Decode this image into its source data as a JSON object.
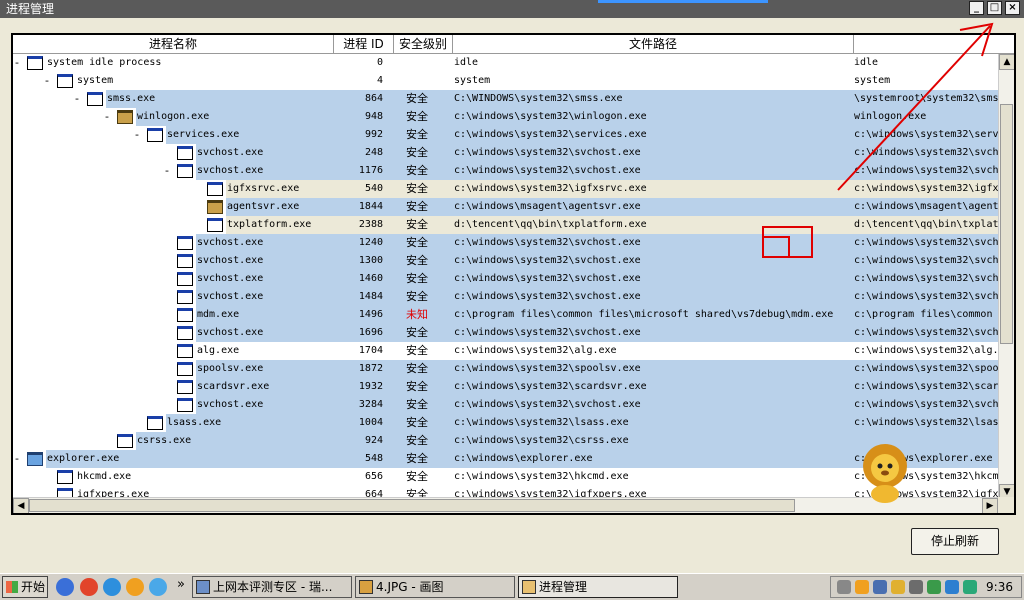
{
  "window": {
    "title": "进程管理",
    "minimize": "_",
    "maximize": "□",
    "close": "×"
  },
  "columns": [
    "进程名称",
    "进程 ID",
    "安全级别",
    "文件路径",
    ""
  ],
  "rows": [
    {
      "exp": "-",
      "name": "system idle process",
      "pid": "0",
      "sec": "",
      "path": "idle",
      "path2": "idle",
      "level": 0,
      "hl": false
    },
    {
      "exp": "-",
      "name": "system",
      "pid": "4",
      "sec": "",
      "path": "system",
      "path2": "system",
      "level": 1,
      "hl": false
    },
    {
      "exp": "-",
      "name": "smss.exe",
      "pid": "864",
      "sec": "安全",
      "path": "C:\\WINDOWS\\system32\\smss.exe",
      "path2": "\\systemroot\\system32\\smss",
      "level": 2,
      "hl": true
    },
    {
      "exp": "-",
      "name": "winlogon.exe",
      "pid": "948",
      "sec": "安全",
      "path": "c:\\windows\\system32\\winlogon.exe",
      "path2": "winlogon.exe",
      "level": 3,
      "hl": true,
      "icon": "special"
    },
    {
      "exp": "-",
      "name": "services.exe",
      "pid": "992",
      "sec": "安全",
      "path": "c:\\windows\\system32\\services.exe",
      "path2": "c:\\windows\\system32\\serv",
      "level": 4,
      "hl": true
    },
    {
      "exp": "",
      "name": "svchost.exe",
      "pid": "248",
      "sec": "安全",
      "path": "c:\\windows\\system32\\svchost.exe",
      "path2": "c:\\windows\\system32\\svch",
      "level": 5,
      "hl": true
    },
    {
      "exp": "-",
      "name": "svchost.exe",
      "pid": "1176",
      "sec": "安全",
      "path": "c:\\windows\\system32\\svchost.exe",
      "path2": "c:\\windows\\system32\\svch",
      "level": 5,
      "hl": true
    },
    {
      "exp": "",
      "name": "igfxsrvc.exe",
      "pid": "540",
      "sec": "安全",
      "path": "c:\\windows\\system32\\igfxsrvc.exe",
      "path2": "c:\\windows\\system32\\igfx",
      "level": 6,
      "hl": false,
      "beige": true
    },
    {
      "exp": "",
      "name": "agentsvr.exe",
      "pid": "1844",
      "sec": "安全",
      "path": "c:\\windows\\msagent\\agentsvr.exe",
      "path2": "c:\\windows\\msagent\\agent",
      "level": 6,
      "hl": true,
      "icon": "special"
    },
    {
      "exp": "",
      "name": "txplatform.exe",
      "pid": "2388",
      "sec": "安全",
      "path": "d:\\tencent\\qq\\bin\\txplatform.exe",
      "path2": "d:\\tencent\\qq\\bin\\txplat",
      "level": 6,
      "hl": false,
      "beige": true
    },
    {
      "exp": "",
      "name": "svchost.exe",
      "pid": "1240",
      "sec": "安全",
      "path": "c:\\windows\\system32\\svchost.exe",
      "path2": "c:\\windows\\system32\\svch",
      "level": 5,
      "hl": true
    },
    {
      "exp": "",
      "name": "svchost.exe",
      "pid": "1300",
      "sec": "安全",
      "path": "c:\\windows\\system32\\svchost.exe",
      "path2": "c:\\windows\\system32\\svch",
      "level": 5,
      "hl": true
    },
    {
      "exp": "",
      "name": "svchost.exe",
      "pid": "1460",
      "sec": "安全",
      "path": "c:\\windows\\system32\\svchost.exe",
      "path2": "c:\\windows\\system32\\svch",
      "level": 5,
      "hl": true
    },
    {
      "exp": "",
      "name": "svchost.exe",
      "pid": "1484",
      "sec": "安全",
      "path": "c:\\windows\\system32\\svchost.exe",
      "path2": "c:\\windows\\system32\\svch",
      "level": 5,
      "hl": true
    },
    {
      "exp": "",
      "name": "mdm.exe",
      "pid": "1496",
      "sec": "未知",
      "path": "c:\\program files\\common files\\microsoft shared\\vs7debug\\mdm.exe",
      "path2": "c:\\program files\\common",
      "level": 5,
      "hl": true,
      "unknown": true
    },
    {
      "exp": "",
      "name": "svchost.exe",
      "pid": "1696",
      "sec": "安全",
      "path": "c:\\windows\\system32\\svchost.exe",
      "path2": "c:\\windows\\system32\\svch",
      "level": 5,
      "hl": true
    },
    {
      "exp": "",
      "name": "alg.exe",
      "pid": "1704",
      "sec": "安全",
      "path": "c:\\windows\\system32\\alg.exe",
      "path2": "c:\\windows\\system32\\alg.",
      "level": 5,
      "hl": false
    },
    {
      "exp": "",
      "name": "spoolsv.exe",
      "pid": "1872",
      "sec": "安全",
      "path": "c:\\windows\\system32\\spoolsv.exe",
      "path2": "c:\\windows\\system32\\spoo",
      "level": 5,
      "hl": true
    },
    {
      "exp": "",
      "name": "scardsvr.exe",
      "pid": "1932",
      "sec": "安全",
      "path": "c:\\windows\\system32\\scardsvr.exe",
      "path2": "c:\\windows\\system32\\scar",
      "level": 5,
      "hl": true
    },
    {
      "exp": "",
      "name": "svchost.exe",
      "pid": "3284",
      "sec": "安全",
      "path": "c:\\windows\\system32\\svchost.exe",
      "path2": "c:\\windows\\system32\\svch",
      "level": 5,
      "hl": true
    },
    {
      "exp": "",
      "name": "lsass.exe",
      "pid": "1004",
      "sec": "安全",
      "path": "c:\\windows\\system32\\lsass.exe",
      "path2": "c:\\windows\\system32\\lsas",
      "level": 4,
      "hl": true
    },
    {
      "exp": "",
      "name": "csrss.exe",
      "pid": "924",
      "sec": "安全",
      "path": "c:\\windows\\system32\\csrss.exe",
      "path2": "",
      "level": 3,
      "hl": true
    },
    {
      "exp": "-",
      "name": "explorer.exe",
      "pid": "548",
      "sec": "安全",
      "path": "c:\\windows\\explorer.exe",
      "path2": "c:\\windows\\explorer.exe",
      "level": 0,
      "hl": true,
      "icon": "globe"
    },
    {
      "exp": "",
      "name": "hkcmd.exe",
      "pid": "656",
      "sec": "安全",
      "path": "c:\\windows\\system32\\hkcmd.exe",
      "path2": "c:\\windows\\system32\\hkcm",
      "level": 1,
      "hl": false
    },
    {
      "exp": "",
      "name": "igfxpers.exe",
      "pid": "664",
      "sec": "安全",
      "path": "c:\\windows\\system32\\igfxpers.exe",
      "path2": "c:\\windows\\system32\\igfx",
      "level": 1,
      "hl": false
    }
  ],
  "stop_button": "停止刷新",
  "taskbar": {
    "start": "开始",
    "tasks": [
      "上网本评测专区 - 瑞...",
      "4.JPG - 画图",
      "进程管理"
    ],
    "clock": "9:36",
    "overflow": "»"
  },
  "colors": {
    "row_highlight": "#b9d1ea",
    "row_beige": "#ece9d8",
    "unknown_text": "#e00000"
  }
}
